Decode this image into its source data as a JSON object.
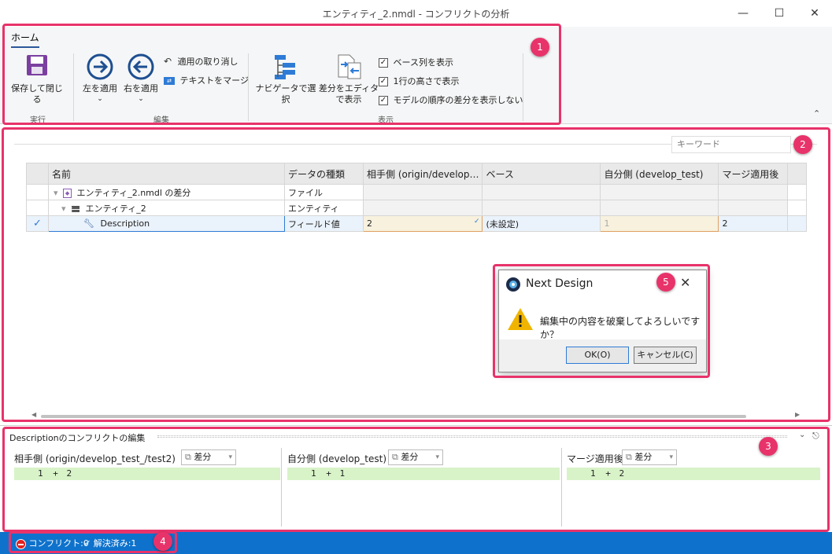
{
  "window": {
    "title": "エンティティ_2.nmdl - コンフリクトの分析"
  },
  "ribbon": {
    "tab": "ホーム",
    "groups": {
      "execute": "実行",
      "edit": "編集",
      "view": "表示"
    },
    "buttons": {
      "save_close": "保存して閉じる",
      "apply_left": "左を適用",
      "apply_right": "右を適用",
      "undo_apply": "適用の取り消し",
      "text_merge": "テキストをマージ",
      "navigator_select_1": "ナビゲータで選択",
      "show_diff_editor_1": "差分をエディタ",
      "show_diff_editor_2": "で表示"
    },
    "checkboxes": {
      "show_base": "ベース列を表示",
      "one_line_height": "1行の高さで表示",
      "hide_model_order": "モデルの順序の差分を表示しない"
    }
  },
  "search": {
    "placeholder": "キーワード"
  },
  "grid": {
    "headers": [
      "名前",
      "データの種類",
      "相手側 (origin/develop…",
      "ベース",
      "自分側 (develop_test)",
      "マージ適用後"
    ],
    "rows": [
      {
        "name": "エンティティ_2.nmdl の差分",
        "type": "ファイル",
        "theirs": "",
        "base": "",
        "mine": "",
        "merged": ""
      },
      {
        "name": "エンティティ_2",
        "type": "エンティティ",
        "theirs": "",
        "base": "",
        "mine": "",
        "merged": ""
      },
      {
        "name": "Description",
        "type": "フィールド値",
        "theirs": "2",
        "base": "(未設定)",
        "mine": "1",
        "merged": "2"
      }
    ]
  },
  "dialog": {
    "title": "Next Design",
    "message": "編集中の内容を破棄してよろしいですか？",
    "ok": "OK(O)",
    "cancel": "キャンセル(C)"
  },
  "bottom_panel": {
    "title": "Descriptionのコンフリクトの編集",
    "diff_label": "差分",
    "theirs_title": "相手側 (origin/develop_test_/test2)",
    "mine_title": "自分側 (develop_test)",
    "merged_title": "マージ適用後",
    "theirs_line": {
      "num": "1",
      "sign": "+",
      "text": "2"
    },
    "mine_line": {
      "num": "1",
      "sign": "+",
      "text": "1"
    },
    "merged_line": {
      "num": "1",
      "sign": "+",
      "text": "2"
    }
  },
  "status": {
    "conflict": "コンフリクト:0",
    "resolved": "解決済み:1"
  },
  "callouts": [
    "1",
    "2",
    "3",
    "4",
    "5"
  ],
  "colors": {
    "accent": "#2b579a",
    "callout": "#e8336a",
    "status_bar": "#0e72cc",
    "diff_added": "#d8f3c8"
  }
}
